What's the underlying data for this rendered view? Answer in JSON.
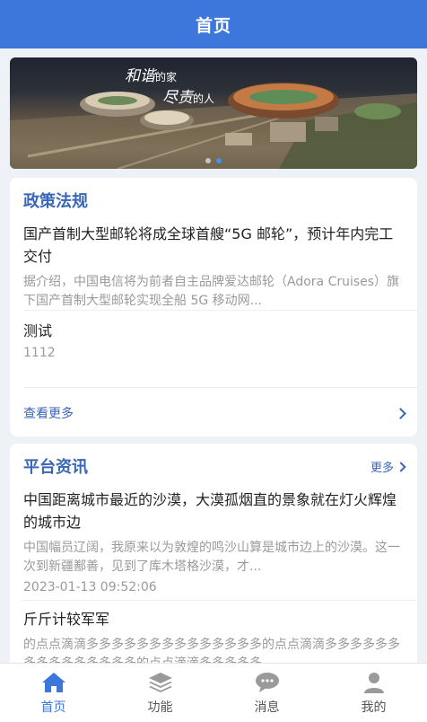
{
  "header": {
    "title": "首页"
  },
  "banner": {
    "slogan_line1_big": "和谐",
    "slogan_line1_small": "的家",
    "slogan_line2_big": "尽责",
    "slogan_line2_small": "的人",
    "slide_count": 2,
    "active_slide": 2
  },
  "policy": {
    "title": "政策法规",
    "items": [
      {
        "title": "国产首制大型邮轮将成全球首艘“5G 邮轮”，预计年内完工交付",
        "desc": "据介绍，中国电信将为前者自主品牌爱达邮轮（Adora Cruises）旗下国产首制大型邮轮实现全船 5G 移动网..."
      },
      {
        "title": "测试",
        "meta": "1112"
      }
    ],
    "see_more": "查看更多"
  },
  "platform": {
    "title": "平台资讯",
    "more": "更多",
    "items": [
      {
        "title": "中国距离城市最近的沙漠，大漠孤烟直的景象就在灯火辉煌的城市边",
        "desc": "中国幅员辽阔，我原来以为敦煌的鸣沙山算是城市边上的沙漠。这一次到新疆鄯善，见到了库木塔格沙漠，才...",
        "time": "2023-01-13 09:52:06"
      },
      {
        "title": "斤斤计较军军",
        "desc": "的点点滴滴多多多多多多多多多多多多多多的点点滴滴多多多多多多多多多多多多多多多的点点滴滴多多多多多"
      }
    ]
  },
  "tabbar": {
    "tabs": [
      {
        "label": "首页",
        "icon": "home-icon",
        "active": true
      },
      {
        "label": "功能",
        "icon": "layers-icon",
        "active": false
      },
      {
        "label": "消息",
        "icon": "chat-bubble-icon",
        "active": false
      },
      {
        "label": "我的",
        "icon": "user-icon",
        "active": false
      }
    ]
  },
  "colors": {
    "primary": "#3d77dc",
    "section_title": "#3a66b8",
    "muted_text": "#9a9a9a"
  }
}
